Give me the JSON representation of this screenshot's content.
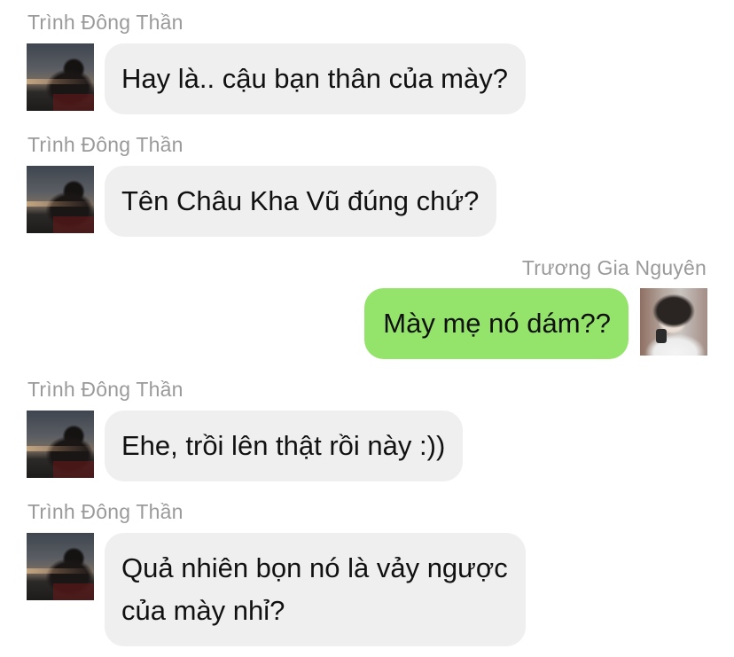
{
  "messages": [
    {
      "direction": "incoming",
      "sender": "Trình Đông Thần",
      "avatar": "avatar-trinh-dong-than",
      "lines": [
        "Hay là.. cậu bạn thân của mày?"
      ]
    },
    {
      "direction": "incoming",
      "sender": "Trình Đông Thần",
      "avatar": "avatar-trinh-dong-than",
      "lines": [
        "Tên Châu Kha Vũ đúng chứ?"
      ]
    },
    {
      "direction": "outgoing",
      "sender": "Trương Gia Nguyên",
      "avatar": "avatar-truong-gia-nguyen",
      "lines": [
        "Mày mẹ nó dám??"
      ]
    },
    {
      "direction": "incoming",
      "sender": "Trình Đông Thần",
      "avatar": "avatar-trinh-dong-than",
      "lines": [
        "Ehe, trồi lên thật rồi này :))"
      ]
    },
    {
      "direction": "incoming",
      "sender": "Trình Đông Thần",
      "avatar": "avatar-trinh-dong-than",
      "lines": [
        "Quả nhiên bọn nó là vảy ngược",
        "của mày nhỉ?"
      ]
    }
  ],
  "colors": {
    "incoming_bubble": "#efefef",
    "outgoing_bubble": "#94e36a",
    "sender_name": "#9a9a9a",
    "text": "#111111"
  }
}
